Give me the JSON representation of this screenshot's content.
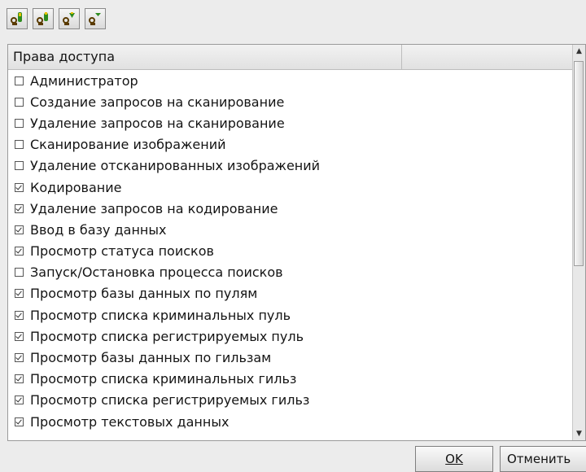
{
  "toolbar": {
    "buttons": [
      {
        "icon": "user-key-icon"
      },
      {
        "icon": "user-key-add-icon"
      },
      {
        "icon": "user-key-down-icon"
      },
      {
        "icon": "user-key-remove-icon"
      }
    ]
  },
  "list": {
    "column_header": "Права доступа",
    "items": [
      {
        "label": "Администратор",
        "checked": false
      },
      {
        "label": "Создание запросов на сканирование",
        "checked": false
      },
      {
        "label": "Удаление запросов на сканирование",
        "checked": false
      },
      {
        "label": "Сканирование изображений",
        "checked": false
      },
      {
        "label": "Удаление отсканированных изображений",
        "checked": false
      },
      {
        "label": "Кодирование",
        "checked": true
      },
      {
        "label": "Удаление запросов на кодирование",
        "checked": true
      },
      {
        "label": "Ввод в базу данных",
        "checked": true
      },
      {
        "label": "Просмотр статуса поисков",
        "checked": true
      },
      {
        "label": "Запуск/Остановка процесса поисков",
        "checked": false
      },
      {
        "label": "Просмотр базы данных по пулям",
        "checked": true
      },
      {
        "label": "Просмотр списка криминальных пуль",
        "checked": true
      },
      {
        "label": "Просмотр списка регистрируемых пуль",
        "checked": true
      },
      {
        "label": "Просмотр базы данных по гильзам",
        "checked": true
      },
      {
        "label": "Просмотр списка криминальных гильз",
        "checked": true
      },
      {
        "label": "Просмотр списка регистрируемых гильз",
        "checked": true
      },
      {
        "label": "Просмотр текстовых данных",
        "checked": true
      }
    ]
  },
  "buttons": {
    "ok_label": "OK",
    "cancel_label": "Отменить"
  },
  "colors": {
    "window_bg": "#ececec",
    "list_bg": "#ffffff",
    "icon_green": "#2e8b1f",
    "icon_yellow": "#e6c200"
  }
}
